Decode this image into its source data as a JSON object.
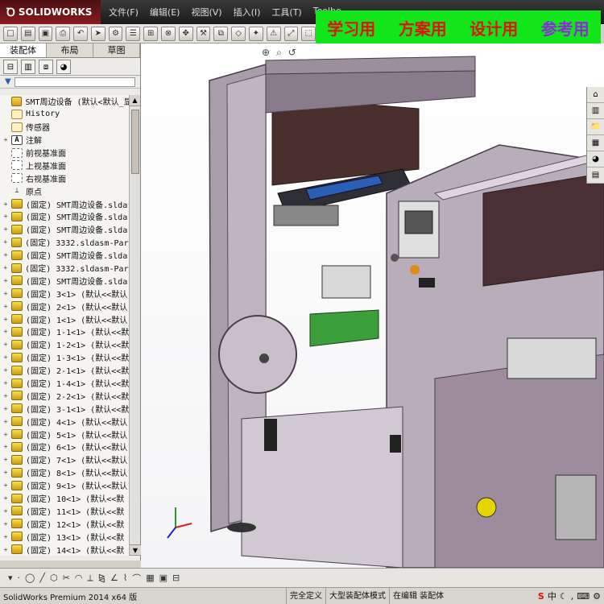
{
  "app": {
    "logo_text": "SOLIDWORKS"
  },
  "menu": [
    "文件(F)",
    "编辑(E)",
    "视图(V)",
    "插入(I)",
    "工具(T)",
    "Toolbo"
  ],
  "banner": {
    "items": [
      "学习用",
      "方案用",
      "设计用",
      "参考用"
    ]
  },
  "panel": {
    "tabs": [
      "装配体",
      "布局",
      "草图"
    ],
    "tree": [
      {
        "label": "SMT周边设备  (默认<默认_显",
        "icon": "root",
        "exp": ""
      },
      {
        "label": "History",
        "icon": "folder",
        "exp": ""
      },
      {
        "label": "传感器",
        "icon": "folder",
        "exp": ""
      },
      {
        "label": "注解",
        "icon": "note",
        "exp": "+"
      },
      {
        "label": "前视基准面",
        "icon": "plane",
        "exp": ""
      },
      {
        "label": "上视基准面",
        "icon": "plane",
        "exp": ""
      },
      {
        "label": "右视基准面",
        "icon": "plane",
        "exp": ""
      },
      {
        "label": "原点",
        "icon": "origin",
        "exp": ""
      },
      {
        "label": "(固定) SMT周边设备.slda",
        "icon": "part",
        "exp": "+"
      },
      {
        "label": "(固定) SMT周边设备.slda",
        "icon": "part",
        "exp": "+"
      },
      {
        "label": "(固定) SMT周边设备.slda",
        "icon": "part",
        "exp": "+"
      },
      {
        "label": "(固定) 3332.sldasm-Part",
        "icon": "part",
        "exp": "+"
      },
      {
        "label": "(固定) SMT周边设备.slda",
        "icon": "part",
        "exp": "+"
      },
      {
        "label": "(固定) 3332.sldasm-Part",
        "icon": "part",
        "exp": "+"
      },
      {
        "label": "(固定) SMT周边设备.slda",
        "icon": "part",
        "exp": "+"
      },
      {
        "label": "(固定) 3<1> (默认<<默认",
        "icon": "part",
        "exp": "+"
      },
      {
        "label": "(固定) 2<1> (默认<<默认",
        "icon": "part",
        "exp": "+"
      },
      {
        "label": "(固定) 1<1> (默认<<默认",
        "icon": "part",
        "exp": "+"
      },
      {
        "label": "(固定) 1-1<1> (默认<<默",
        "icon": "part",
        "exp": "+"
      },
      {
        "label": "(固定) 1-2<1> (默认<<默",
        "icon": "part",
        "exp": "+"
      },
      {
        "label": "(固定) 1-3<1> (默认<<默",
        "icon": "part",
        "exp": "+"
      },
      {
        "label": "(固定) 2-1<1> (默认<<默",
        "icon": "part",
        "exp": "+"
      },
      {
        "label": "(固定) 1-4<1> (默认<<默",
        "icon": "part",
        "exp": "+"
      },
      {
        "label": "(固定) 2-2<1> (默认<<默",
        "icon": "part",
        "exp": "+"
      },
      {
        "label": "(固定) 3-1<1> (默认<<默",
        "icon": "part",
        "exp": "+"
      },
      {
        "label": "(固定) 4<1> (默认<<默认",
        "icon": "part",
        "exp": "+"
      },
      {
        "label": "(固定) 5<1> (默认<<默认",
        "icon": "part",
        "exp": "+"
      },
      {
        "label": "(固定) 6<1> (默认<<默认",
        "icon": "part",
        "exp": "+"
      },
      {
        "label": "(固定) 7<1> (默认<<默认",
        "icon": "part",
        "exp": "+"
      },
      {
        "label": "(固定) 8<1> (默认<<默认",
        "icon": "part",
        "exp": "+"
      },
      {
        "label": "(固定) 9<1> (默认<<默认",
        "icon": "part",
        "exp": "+"
      },
      {
        "label": "(固定) 10<1> (默认<<默",
        "icon": "part",
        "exp": "+"
      },
      {
        "label": "(固定) 11<1> (默认<<默",
        "icon": "part",
        "exp": "+"
      },
      {
        "label": "(固定) 12<1> (默认<<默",
        "icon": "part",
        "exp": "+"
      },
      {
        "label": "(固定) 13<1> (默认<<默",
        "icon": "part",
        "exp": "+"
      },
      {
        "label": "(固定) 14<1> (默认<<默",
        "icon": "part",
        "exp": "+"
      }
    ]
  },
  "status": {
    "version": "SolidWorks Premium 2014 x64 版",
    "cells": [
      "完全定义",
      "大型装配体模式",
      "在编辑 装配体"
    ]
  },
  "colors": {
    "banner_bg": "#12e61b",
    "banner_red": "#e0120b",
    "banner_purple": "#8a2bd6",
    "machine_body": "#b6a9b8",
    "machine_panel": "#7a5c72"
  }
}
